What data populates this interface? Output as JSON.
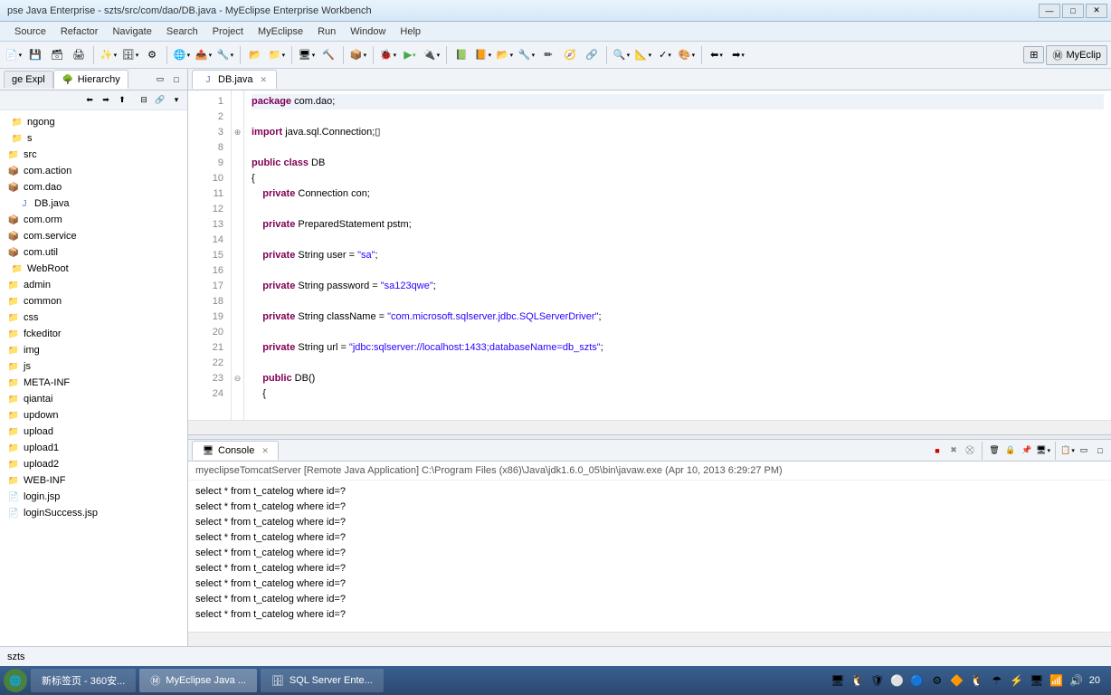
{
  "window": {
    "title": "pse Java Enterprise - szts/src/com/dao/DB.java - MyEclipse Enterprise Workbench"
  },
  "menu": [
    "Source",
    "Refactor",
    "Navigate",
    "Search",
    "Project",
    "MyEclipse",
    "Run",
    "Window",
    "Help"
  ],
  "perspective": "MyEclip",
  "leftPanel": {
    "tabs": [
      "ge Expl",
      "Hierarchy"
    ],
    "tree": [
      {
        "label": "ngong",
        "indent": 0,
        "icon": "folder"
      },
      {
        "label": "s",
        "indent": 0,
        "icon": "folder"
      },
      {
        "label": "src",
        "indent": 1,
        "icon": "folder"
      },
      {
        "label": "com.action",
        "indent": 1,
        "icon": "package"
      },
      {
        "label": "com.dao",
        "indent": 1,
        "icon": "package"
      },
      {
        "label": "DB.java",
        "indent": 2,
        "icon": "java"
      },
      {
        "label": "com.orm",
        "indent": 1,
        "icon": "package"
      },
      {
        "label": "com.service",
        "indent": 1,
        "icon": "package"
      },
      {
        "label": "com.util",
        "indent": 1,
        "icon": "package"
      },
      {
        "label": "WebRoot",
        "indent": 0,
        "icon": "folder"
      },
      {
        "label": "admin",
        "indent": 1,
        "icon": "folder"
      },
      {
        "label": "common",
        "indent": 1,
        "icon": "folder"
      },
      {
        "label": "css",
        "indent": 1,
        "icon": "folder"
      },
      {
        "label": "fckeditor",
        "indent": 1,
        "icon": "folder"
      },
      {
        "label": "img",
        "indent": 1,
        "icon": "folder"
      },
      {
        "label": "js",
        "indent": 1,
        "icon": "folder"
      },
      {
        "label": "META-INF",
        "indent": 1,
        "icon": "folder"
      },
      {
        "label": "qiantai",
        "indent": 1,
        "icon": "folder"
      },
      {
        "label": "updown",
        "indent": 1,
        "icon": "folder"
      },
      {
        "label": "upload",
        "indent": 1,
        "icon": "folder"
      },
      {
        "label": "upload1",
        "indent": 1,
        "icon": "folder"
      },
      {
        "label": "upload2",
        "indent": 1,
        "icon": "folder"
      },
      {
        "label": "WEB-INF",
        "indent": 1,
        "icon": "folder"
      },
      {
        "label": "login.jsp",
        "indent": 1,
        "icon": "file"
      },
      {
        "label": "loginSuccess.jsp",
        "indent": 1,
        "icon": "file"
      }
    ]
  },
  "editor": {
    "tab": "DB.java",
    "lines": [
      {
        "n": 1,
        "hl": true,
        "html": "<span class='kw'>package</span> com.dao;"
      },
      {
        "n": 2,
        "html": ""
      },
      {
        "n": 3,
        "fold": "+",
        "html": "<span class='kw'>import</span> java.sql.Connection;▯"
      },
      {
        "n": 8,
        "html": ""
      },
      {
        "n": 9,
        "html": "<span class='kw'>public</span> <span class='kw'>class</span> DB"
      },
      {
        "n": 10,
        "html": "{"
      },
      {
        "n": 11,
        "html": "    <span class='kw'>private</span> Connection con;"
      },
      {
        "n": 12,
        "html": ""
      },
      {
        "n": 13,
        "html": "    <span class='kw'>private</span> PreparedStatement pstm;"
      },
      {
        "n": 14,
        "html": ""
      },
      {
        "n": 15,
        "html": "    <span class='kw'>private</span> String user = <span class='str'>\"sa\"</span>;"
      },
      {
        "n": 16,
        "html": ""
      },
      {
        "n": 17,
        "html": "    <span class='kw'>private</span> String password = <span class='str'>\"sa123qwe\"</span>;"
      },
      {
        "n": 18,
        "html": ""
      },
      {
        "n": 19,
        "html": "    <span class='kw'>private</span> String className = <span class='str'>\"com.microsoft.sqlserver.jdbc.SQLServerDriver\"</span>;"
      },
      {
        "n": 20,
        "html": ""
      },
      {
        "n": 21,
        "html": "    <span class='kw'>private</span> String url = <span class='str'>\"jdbc:sqlserver://localhost:1433;databaseName=db_szts\"</span>;"
      },
      {
        "n": 22,
        "html": ""
      },
      {
        "n": 23,
        "fold": "-",
        "html": "    <span class='kw'>public</span> DB()"
      },
      {
        "n": 24,
        "html": "    {"
      }
    ]
  },
  "console": {
    "tab": "Console",
    "info": "myeclipseTomcatServer [Remote Java Application] C:\\Program Files (x86)\\Java\\jdk1.6.0_05\\bin\\javaw.exe (Apr 10, 2013 6:29:27 PM)",
    "lines": [
      "select * from t_catelog where id=?",
      "select * from t_catelog where id=?",
      "select * from t_catelog where id=?",
      "select * from t_catelog where id=?",
      "select * from t_catelog where id=?",
      "select * from t_catelog where id=?",
      "select * from t_catelog where id=?",
      "select * from t_catelog where id=?",
      "select * from t_catelog where id=?"
    ]
  },
  "status": "szts",
  "taskbar": {
    "items": [
      {
        "label": "新标签页 - 360安..."
      },
      {
        "label": "MyEclipse Java ..."
      },
      {
        "label": "SQL Server Ente..."
      }
    ],
    "clock": "20"
  }
}
